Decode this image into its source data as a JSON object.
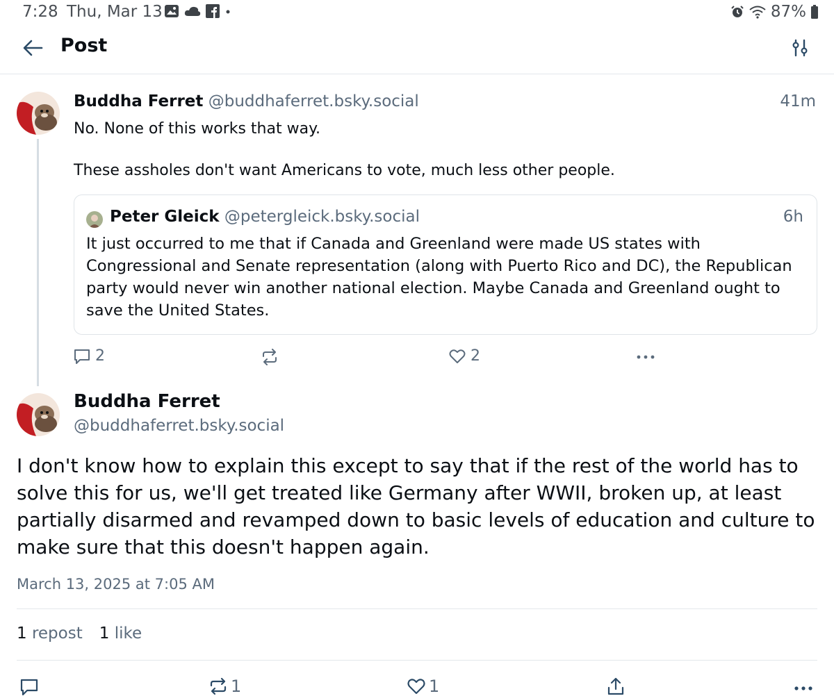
{
  "status_bar": {
    "time": "7:28",
    "date": "Thu, Mar 13",
    "battery": "87%"
  },
  "header": {
    "title": "Post"
  },
  "parent_post": {
    "author_name": "Buddha Ferret",
    "author_handle": "@buddhaferret.bsky.social",
    "time": "41m",
    "line1": "No. None of this works that way.",
    "line2": "These assholes don't want Americans to vote, much less other people.",
    "quote": {
      "author_name": "Peter Gleick",
      "author_handle": "@petergleick.bsky.social",
      "time": "6h",
      "text": "It just occurred to me that if Canada and Greenland were made US states with Congressional and Senate representation (along with Puerto Rico and DC), the Republican party would never win another national election. Maybe Canada and Greenland ought to save the United States."
    },
    "actions": {
      "reply_count": "2",
      "like_count": "2"
    }
  },
  "main_post": {
    "author_name": "Buddha Ferret",
    "author_handle": "@buddhaferret.bsky.social",
    "text": "I don't know how to explain this except to say that if the rest of the world has to solve this for us, we'll get treated like Germany after WWII, broken up, at least partially disarmed and revamped down to basic levels of education and culture to make sure that this doesn't happen again.",
    "timestamp": "March 13, 2025 at 7:05 AM",
    "repost_count": "1",
    "repost_label": "repost",
    "like_count": "1",
    "like_label": "like",
    "actions": {
      "repost_count": "1",
      "like_count": "1"
    }
  },
  "colors": {
    "accent": "#1083fe",
    "muted": "#5b6b7c",
    "divider": "#e3e7eb"
  }
}
